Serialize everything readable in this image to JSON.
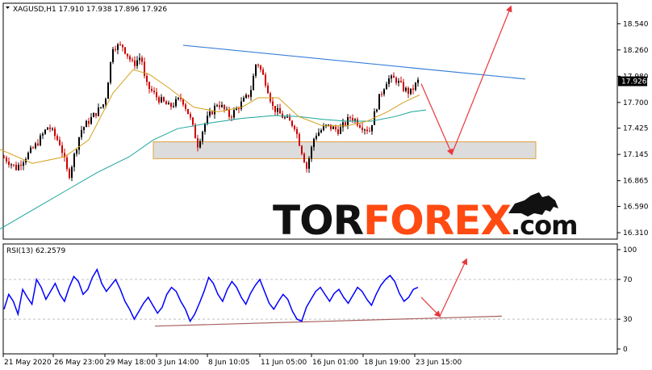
{
  "window": {
    "symbol_header": "XAGUSD,H1  17.910  17.938  17.896  17.926",
    "rsi_header": "RSI(13) 62.2579"
  },
  "watermark": {
    "part1": "TOR",
    "part2": "FOREX",
    "part3": ".com"
  },
  "colors": {
    "background": "#ffffff",
    "grid": "#c0c0c0",
    "candle_up": "#000000",
    "candle_down": "#cc0000",
    "ma_fast": "#d4a017",
    "ma_slow": "#1aa59a",
    "resistance_line": "#3a7fd8",
    "forecast_arrow": "#e8373c",
    "support_zone": "#dcdcdc",
    "support_zone_border": "#e3a040",
    "rsi_line": "#0000ff",
    "rsi_trendline": "#a86060",
    "watermark_dark": "#111111",
    "watermark_accent": "#ff4a12"
  },
  "chart_data": [
    {
      "type": "candlestick",
      "symbol": "XAGUSD",
      "timeframe": "H1",
      "ohlc_last": {
        "open": 17.91,
        "high": 17.938,
        "low": 17.896,
        "close": 17.926
      },
      "ylim": [
        16.25,
        18.75
      ],
      "y_ticks": [
        "18.540",
        "18.260",
        "17.980",
        "17.700",
        "17.425",
        "17.145",
        "16.865",
        "16.590",
        "16.310"
      ],
      "current_price_label": "17.926",
      "x_tick_labels": [
        "21 May 2020",
        "26 May 23:00",
        "29 May 18:00",
        "3 Jun 14:00",
        "8 Jun 10:05",
        "11 Jun 05:00",
        "16 Jun 01:00",
        "18 Jun 19:00",
        "23 Jun 15:00"
      ],
      "price_path": [
        [
          0,
          17.15
        ],
        [
          20,
          17.0
        ],
        [
          45,
          17.25
        ],
        [
          60,
          17.45
        ],
        [
          75,
          17.25
        ],
        [
          85,
          16.9
        ],
        [
          100,
          17.4
        ],
        [
          115,
          17.55
        ],
        [
          130,
          17.7
        ],
        [
          140,
          18.3
        ],
        [
          152,
          18.3
        ],
        [
          165,
          18.1
        ],
        [
          175,
          18.2
        ],
        [
          180,
          17.9
        ],
        [
          195,
          17.75
        ],
        [
          210,
          17.65
        ],
        [
          225,
          17.75
        ],
        [
          235,
          17.55
        ],
        [
          245,
          17.25
        ],
        [
          255,
          17.5
        ],
        [
          270,
          17.7
        ],
        [
          285,
          17.55
        ],
        [
          300,
          17.7
        ],
        [
          310,
          17.8
        ],
        [
          318,
          18.15
        ],
        [
          330,
          17.9
        ],
        [
          338,
          17.65
        ],
        [
          350,
          17.55
        ],
        [
          365,
          17.45
        ],
        [
          375,
          17.15
        ],
        [
          380,
          17.0
        ],
        [
          390,
          17.35
        ],
        [
          405,
          17.45
        ],
        [
          420,
          17.4
        ],
        [
          435,
          17.55
        ],
        [
          448,
          17.45
        ],
        [
          458,
          17.4
        ],
        [
          470,
          17.75
        ],
        [
          480,
          17.95
        ],
        [
          490,
          17.95
        ],
        [
          500,
          17.85
        ],
        [
          508,
          17.8
        ],
        [
          518,
          17.926
        ]
      ],
      "ma_fast_path": [
        [
          0,
          17.2
        ],
        [
          40,
          17.05
        ],
        [
          80,
          17.12
        ],
        [
          110,
          17.3
        ],
        [
          140,
          17.8
        ],
        [
          165,
          18.05
        ],
        [
          185,
          18.0
        ],
        [
          210,
          17.85
        ],
        [
          240,
          17.65
        ],
        [
          270,
          17.6
        ],
        [
          300,
          17.65
        ],
        [
          320,
          17.75
        ],
        [
          345,
          17.75
        ],
        [
          370,
          17.55
        ],
        [
          400,
          17.45
        ],
        [
          430,
          17.45
        ],
        [
          455,
          17.5
        ],
        [
          480,
          17.6
        ],
        [
          500,
          17.7
        ],
        [
          520,
          17.78
        ]
      ],
      "ma_slow_path": [
        [
          0,
          16.35
        ],
        [
          40,
          16.55
        ],
        [
          80,
          16.75
        ],
        [
          120,
          16.95
        ],
        [
          160,
          17.12
        ],
        [
          190,
          17.3
        ],
        [
          220,
          17.42
        ],
        [
          260,
          17.48
        ],
        [
          300,
          17.53
        ],
        [
          340,
          17.56
        ],
        [
          370,
          17.55
        ],
        [
          400,
          17.52
        ],
        [
          430,
          17.5
        ],
        [
          460,
          17.5
        ],
        [
          490,
          17.55
        ],
        [
          510,
          17.6
        ],
        [
          528,
          17.62
        ]
      ],
      "resistance_line": [
        [
          227,
          18.31
        ],
        [
          651,
          17.95
        ]
      ],
      "support_zone": {
        "x0": 190,
        "x1": 664,
        "y_top": 17.28,
        "y_bottom": 17.1
      },
      "forecast": [
        [
          522,
          17.9
        ],
        [
          560,
          17.15
        ],
        [
          633,
          18.72
        ]
      ]
    },
    {
      "type": "line",
      "name": "RSI(13) 62.2579",
      "last_value": 62.2579,
      "ylim": [
        0,
        100
      ],
      "y_ticks": [
        100,
        70,
        30,
        0
      ],
      "levels": [
        70,
        30
      ],
      "values": [
        40,
        55,
        48,
        35,
        60,
        52,
        45,
        70,
        62,
        50,
        58,
        66,
        55,
        48,
        62,
        73,
        68,
        55,
        60,
        72,
        80,
        66,
        58,
        64,
        70,
        60,
        48,
        40,
        30,
        38,
        46,
        52,
        44,
        36,
        42,
        55,
        62,
        58,
        48,
        40,
        28,
        35,
        46,
        58,
        72,
        66,
        55,
        48,
        60,
        68,
        62,
        52,
        45,
        56,
        64,
        70,
        58,
        46,
        40,
        48,
        55,
        50,
        38,
        30,
        28,
        42,
        50,
        58,
        62,
        55,
        48,
        56,
        60,
        52,
        46,
        54,
        62,
        58,
        50,
        44,
        55,
        64,
        70,
        74,
        68,
        56,
        48,
        52,
        60,
        62
      ],
      "trendline": [
        [
          192,
          23
        ],
        [
          622,
          33
        ]
      ],
      "forecast": [
        [
          522,
          52
        ],
        [
          545,
          33
        ],
        [
          578,
          90
        ]
      ]
    }
  ]
}
